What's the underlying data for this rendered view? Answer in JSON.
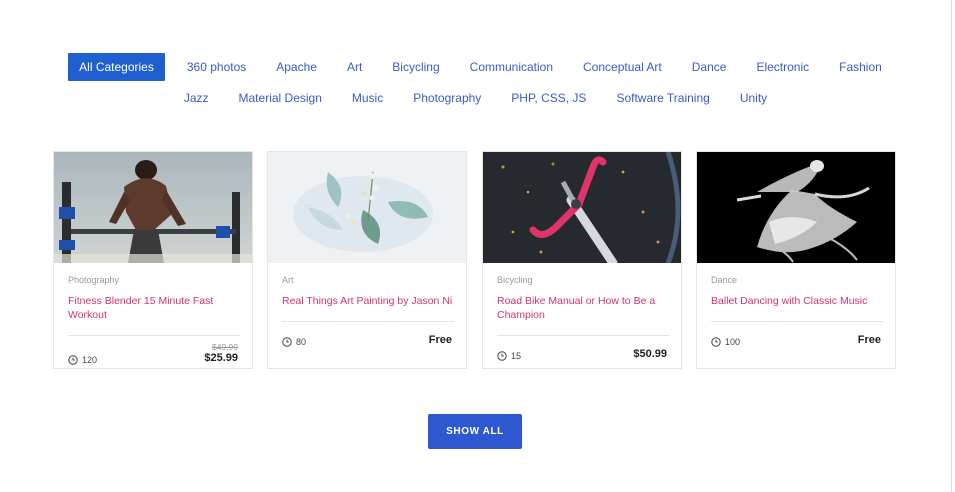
{
  "categories": {
    "active": "All Categories",
    "row1": [
      "360 photos",
      "Apache",
      "Art",
      "Bicycling",
      "Communication",
      "Conceptual Art",
      "Dance",
      "Electronic",
      "Fashion"
    ],
    "row2": [
      "Jazz",
      "Material Design",
      "Music",
      "Photography",
      "PHP, CSS, JS",
      "Software Training",
      "Unity"
    ]
  },
  "courses": [
    {
      "category": "Photography",
      "title": "Fitness Blender 15 Minute Fast Workout",
      "students": "120",
      "old_price": "$49.99",
      "price": "$25.99"
    },
    {
      "category": "Art",
      "title": "Real Things Art Painting by Jason Ni",
      "students": "80",
      "old_price": "",
      "price": "Free"
    },
    {
      "category": "Bicycling",
      "title": "Road Bike Manual or How to Be a Champion",
      "students": "15",
      "old_price": "",
      "price": "$50.99"
    },
    {
      "category": "Dance",
      "title": "Ballet Dancing with Classic Music",
      "students": "100",
      "old_price": "",
      "price": "Free"
    }
  ],
  "show_all_label": "SHOW ALL",
  "icons": {
    "students": "clock-icon"
  },
  "colors": {
    "accent": "#1f5fcf",
    "link": "#3b5cc4",
    "title": "#d1356b",
    "button": "#2f58d0"
  }
}
